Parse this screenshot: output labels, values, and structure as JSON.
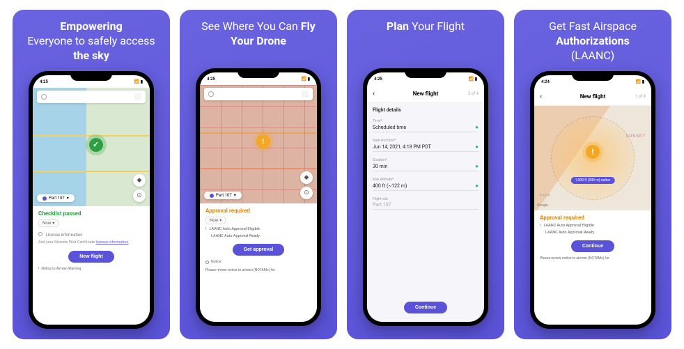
{
  "slides": [
    {
      "title_plain_1": "Empowering",
      "title_plain_2": "Everyone to safely access ",
      "title_bold_2": "the sky"
    },
    {
      "title_plain_1": "See Where You Can ",
      "title_bold_1": "Fly Your Drone"
    },
    {
      "title_bold_1": "Plan",
      "title_plain_1": " Your Flight"
    },
    {
      "title_plain_1": "Get Fast Airspace ",
      "title_bold_1": "Authorizations",
      "title_plain_2": " (LAANC)"
    }
  ],
  "status": {
    "time": "4:25",
    "time_alt": "4:24",
    "signal": "•••",
    "cell": "▮▮▮",
    "batt": "▭"
  },
  "map": {
    "search_placeholder": "",
    "layers_icon": "layers-icon",
    "gps_icon": "gps-icon",
    "profile_pill": "Part 107",
    "profile_caret": "▾",
    "google": "Google"
  },
  "screen1": {
    "status_title": "Checklist passed",
    "dropdown": "Now",
    "license_heading": "License information",
    "license_text": "Add your Remote Pilot Certificate ",
    "license_link": "license information",
    "cta": "New flight",
    "footer": "Notice to Airmen Warning"
  },
  "screen2": {
    "status_title": "Approval required",
    "dropdown": "Now",
    "laanc_1": "LAANC Auto Approval Eligible",
    "laanc_2": "LAANC Auto Approval Ready",
    "cta": "Get approval",
    "footer_prefix": "Notice",
    "footer": "Please review notice to airmen (NOTAMs) for"
  },
  "screen3": {
    "header": "New flight",
    "step": "2 of 4",
    "back": "‹",
    "section": "Flight details",
    "fields": {
      "time_label": "Time*",
      "time_value": "Scheduled time",
      "date_label": "Date and time*",
      "date_value": "Jun 14, 2021, 4:18 PM PDT",
      "duration_label": "Duration*",
      "duration_value": "30 min",
      "alt_label": "Max Altitude*",
      "alt_value": "400 ft (~122 m)",
      "rule_label": "Flight rule",
      "rule_value": "Part 107"
    },
    "cta": "Continue"
  },
  "screen4": {
    "header": "New flight",
    "step": "1 of 4",
    "back": "‹",
    "radius_chip": "1,000 ft (305 m) radius",
    "area_label": "SUNSET",
    "park_label": "PARK",
    "status_title": "Approval required",
    "laanc_1": "LAANC Auto Approval Eligible",
    "laanc_2": "LAANC Auto Approval Ready",
    "cta": "Continue",
    "footer": "Please review notice to airmen (NOTAMs) for"
  }
}
